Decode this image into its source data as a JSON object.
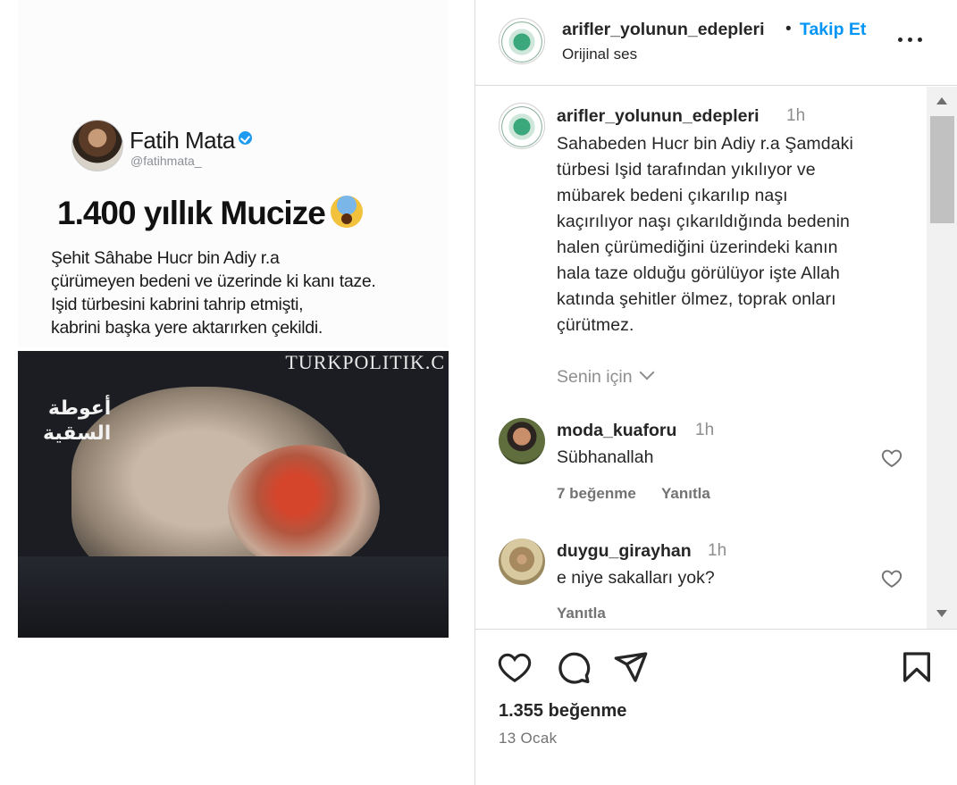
{
  "post_media": {
    "tweet": {
      "name": "Fatih Mata",
      "handle": "@fatihmata_",
      "title": "1.400 yıllık Mucize",
      "emoji": "scream-emoji",
      "body": "Şehit Sâhabe Hucr bin Adiy r.a\nçürümeyen bedeni ve üzerinde ki kanı taze.\nIşid türbesini kabrini tahrip etmişti,\nkabrini başka yere aktarırken çekildi."
    },
    "video": {
      "watermark": "TURKPOLITIK.C",
      "arabic_caption": "أعوطة\nالسقية"
    }
  },
  "header": {
    "username": "arifler_yolunun_edepleri",
    "separator": "•",
    "follow_label": "Takip Et",
    "audio": "Orijinal ses"
  },
  "caption": {
    "username": "arifler_yolunun_edepleri",
    "time": "1h",
    "text": "Sahabeden Hucr bin Adiy r.a Şamdaki\ntürbesi Işid tarafından yıkılıyor ve\nmübarek bedeni çıkarılıp naşı\nkaçırılıyor naşı çıkarıldığında bedenin\nhalen çürümediğini üzerindeki kanın\nhala taze olduğu görülüyor işte Allah\nkatında şehitler ölmez, toprak onları\nçürütmez.",
    "for_you": "Senin için"
  },
  "comments": [
    {
      "username": "moda_kuaforu",
      "time": "1h",
      "text": "Sübhanallah",
      "likes": "7 beğenme",
      "reply": "Yanıtla"
    },
    {
      "username": "duygu_girayhan",
      "time": "1h",
      "text": "e niye sakalları yok?",
      "likes": "",
      "reply": "Yanıtla"
    }
  ],
  "actions": {
    "icons": [
      "heart-icon",
      "comment-icon",
      "share-icon",
      "bookmark-icon"
    ],
    "likes": "1.355 beğenme",
    "date": "13 Ocak"
  },
  "colors": {
    "accent": "#0095f6",
    "text": "#262626",
    "secondary": "#8e8e8e",
    "border": "#dbdbdb",
    "verified": "#1d9bf0"
  }
}
